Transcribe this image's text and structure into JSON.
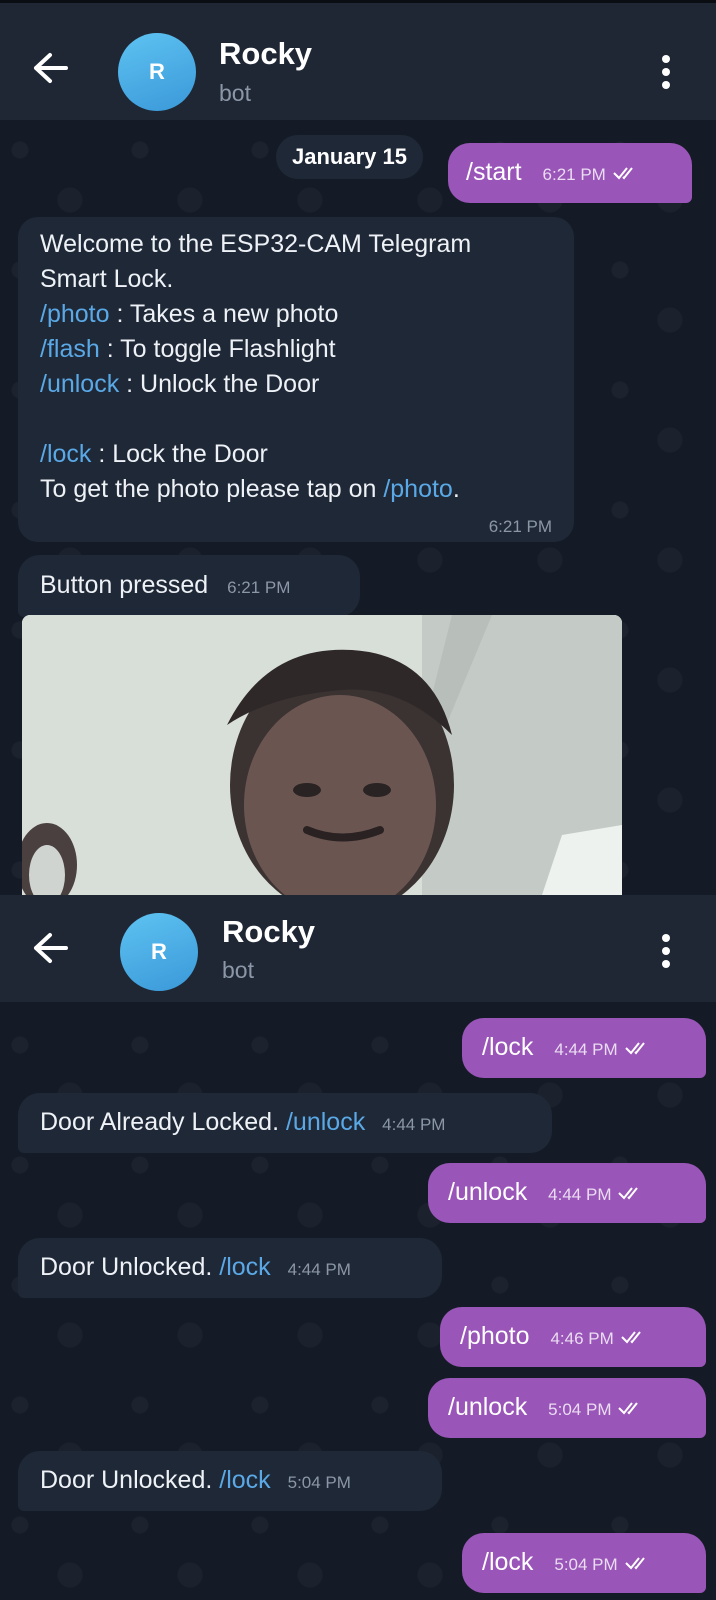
{
  "chat": {
    "name": "Rocky",
    "status": "bot",
    "avatar_letter": "R"
  },
  "panel1": {
    "date": "January 15",
    "start": {
      "text": "/start",
      "time": "6:21 PM"
    },
    "welcome": {
      "line1": "Welcome to the ESP32-CAM Telegram",
      "line2": "Smart Lock.",
      "photo_cmd": "/photo",
      "photo_desc": " : Takes a new photo",
      "flash_cmd": "/flash",
      "flash_desc": " : To toggle Flashlight",
      "unlock_cmd": "/unlock",
      "unlock_desc": " : Unlock the Door",
      "lock_cmd": "/lock",
      "lock_desc": " : Lock the Door",
      "tap_text": "To get the photo please tap on ",
      "tap_cmd": "/photo",
      "tap_end": ".",
      "time": "6:21 PM"
    },
    "button_pressed": {
      "text": "Button pressed",
      "time": "6:21 PM"
    }
  },
  "panel2": {
    "messages": [
      {
        "text": "/lock",
        "time": "4:44 PM"
      },
      {
        "text": "Door Already Locked. ",
        "cmd": "/unlock",
        "time": "4:44 PM"
      },
      {
        "text": "/unlock",
        "time": "4:44 PM"
      },
      {
        "text": "Door Unlocked. ",
        "cmd": "/lock",
        "time": "4:44 PM"
      },
      {
        "text": "/photo",
        "time": "4:46 PM"
      },
      {
        "text": "/unlock",
        "time": "5:04 PM"
      },
      {
        "text": "Door Unlocked. ",
        "cmd": "/lock",
        "time": "5:04 PM"
      },
      {
        "text": "/lock",
        "time": "5:04 PM"
      }
    ]
  },
  "colors": {
    "background": "#141b26",
    "header": "#1f2735",
    "incoming_bubble": "#1f2837",
    "outgoing_bubble": "#9a55b8",
    "link": "#5aa9e6"
  },
  "icons": [
    "back-arrow-icon",
    "more-vert-icon",
    "double-check-icon"
  ]
}
